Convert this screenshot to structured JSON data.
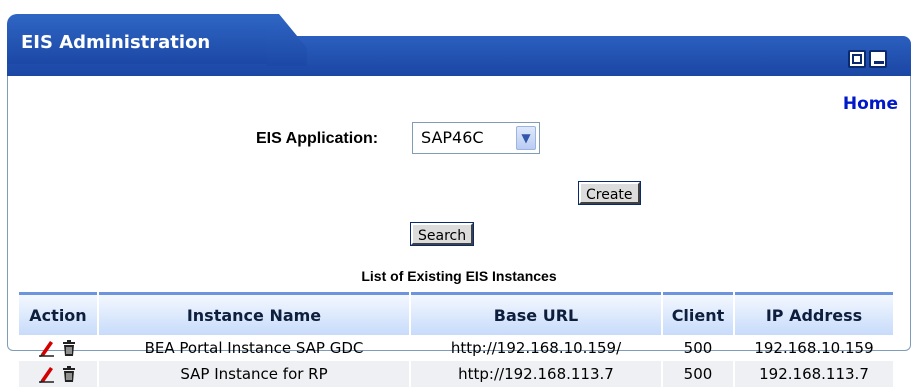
{
  "portlet": {
    "title": "EIS Administration",
    "home_link": "Home"
  },
  "form": {
    "eis_label": "EIS Application:",
    "eis_selected": "SAP46C",
    "create_label": "Create",
    "search_label": "Search"
  },
  "list": {
    "title": "List of Existing EIS Instances",
    "columns": [
      "Action",
      "Instance Name",
      "Base URL",
      "Client",
      "IP Address"
    ],
    "rows": [
      {
        "name": "BEA Portal Instance SAP GDC",
        "url": "http://192.168.10.159/",
        "client": "500",
        "ip": "192.168.10.159"
      },
      {
        "name": "SAP Instance for RP",
        "url": "http://192.168.113.7",
        "client": "500",
        "ip": "192.168.113.7"
      }
    ]
  },
  "icons": {
    "edit": "pencil-edit-icon",
    "delete": "trash-icon"
  },
  "colors": {
    "title_bar": "#1f4fb0",
    "home_link": "#0019c9",
    "header_border": "#6d95dd"
  }
}
